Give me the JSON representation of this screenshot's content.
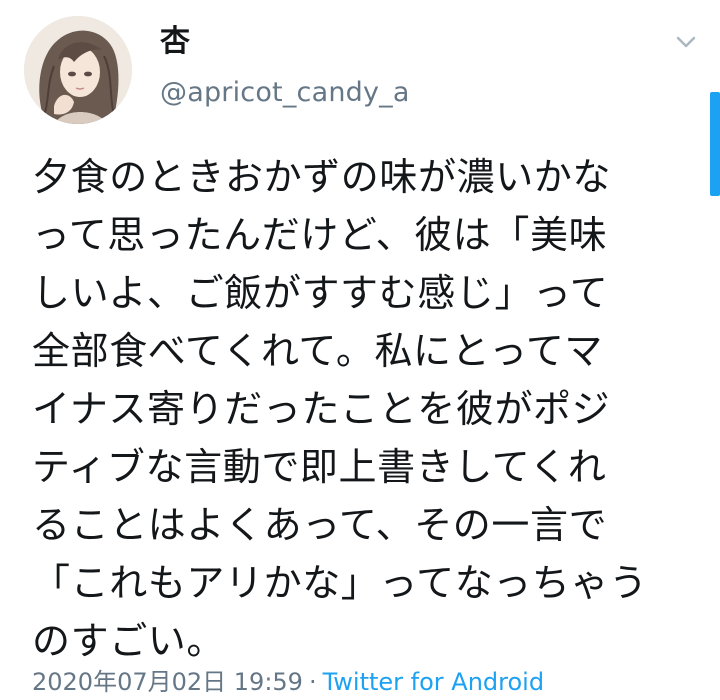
{
  "tweet": {
    "display_name": "杏",
    "handle": "@apricot_candy_a",
    "text": "夕食のときおかずの味が濃いかな\nって思ったんだけど、彼は「美味\nしいよ、ご飯がすすむ感じ」って\n全部食べてくれて。私にとってマ\nイナス寄りだったことを彼がポジ\nティブな言動で即上書きしてくれ\nることはよくあって、その一言で\n「これもアリかな」ってなっちゃう\nのすごい。",
    "timestamp": "2020年07月02日 19:59",
    "separator": "·",
    "source": "Twitter for Android"
  },
  "icons": {
    "menu": "chevron-down-icon",
    "avatar": "avatar-illustration"
  },
  "colors": {
    "text_primary": "#14171a",
    "text_secondary": "#657786",
    "accent": "#1da1f2"
  }
}
